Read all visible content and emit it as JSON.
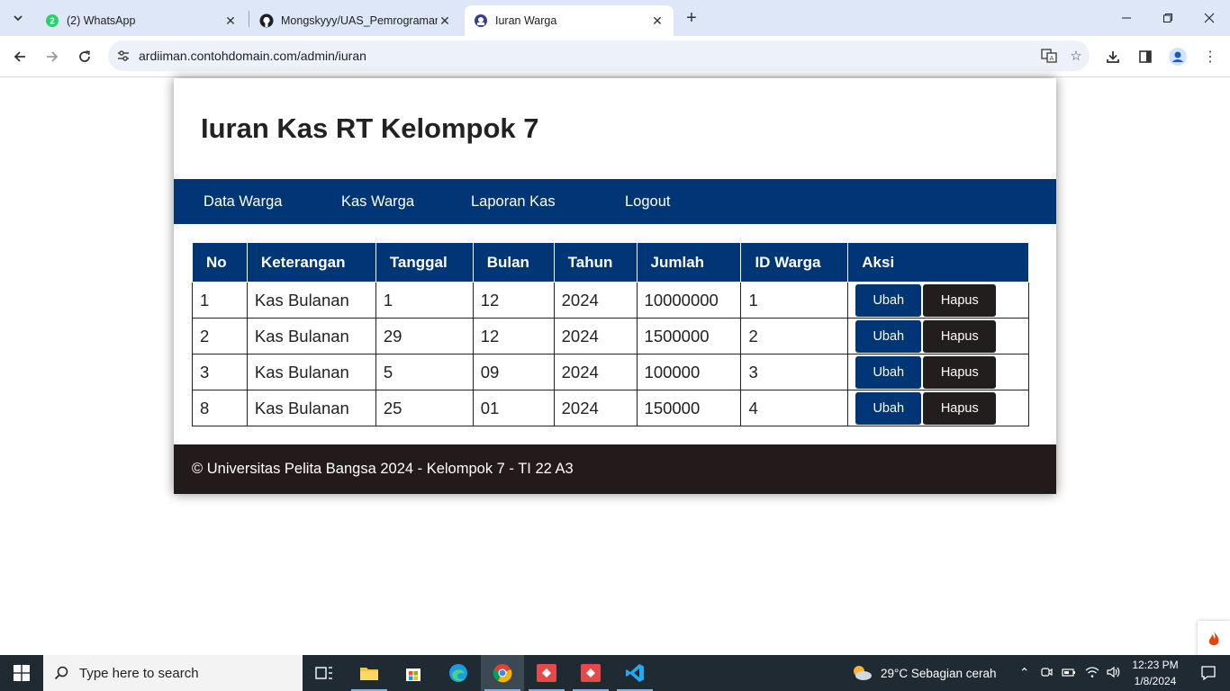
{
  "browser": {
    "tabs": [
      {
        "title": "(2) WhatsApp",
        "badge": "2",
        "icon": "whatsapp-icon"
      },
      {
        "title": "Mongskyyy/UAS_Pemrograman",
        "icon": "github-icon"
      },
      {
        "title": "Iuran Warga",
        "icon": "site-icon"
      }
    ],
    "url": "ardiiman.contohdomain.com/admin/iuran"
  },
  "page": {
    "title": "Iuran Kas RT Kelompok 7",
    "nav": [
      "Data Warga",
      "Kas Warga",
      "Laporan Kas",
      "Logout"
    ],
    "table": {
      "headers": [
        "No",
        "Keterangan",
        "Tanggal",
        "Bulan",
        "Tahun",
        "Jumlah",
        "ID Warga",
        "Aksi"
      ],
      "rows": [
        [
          "1",
          "Kas Bulanan",
          "1",
          "12",
          "2024",
          "10000000",
          "1"
        ],
        [
          "2",
          "Kas Bulanan",
          "29",
          "12",
          "2024",
          "1500000",
          "2"
        ],
        [
          "3",
          "Kas Bulanan",
          "5",
          "09",
          "2024",
          "100000",
          "3"
        ],
        [
          "8",
          "Kas Bulanan",
          "25",
          "01",
          "2024",
          "150000",
          "4"
        ]
      ],
      "edit_label": "Ubah",
      "delete_label": "Hapus"
    },
    "footer": "© Universitas Pelita Bangsa 2024 - Kelompok 7 - TI 22 A3"
  },
  "taskbar": {
    "search_placeholder": "Type here to search",
    "weather": "29°C  Sebagian cerah",
    "time": "12:23 PM",
    "date": "1/8/2024"
  },
  "colors": {
    "primary": "#003576",
    "dark": "#231e1e",
    "tabstrip": "#dee7f7"
  }
}
